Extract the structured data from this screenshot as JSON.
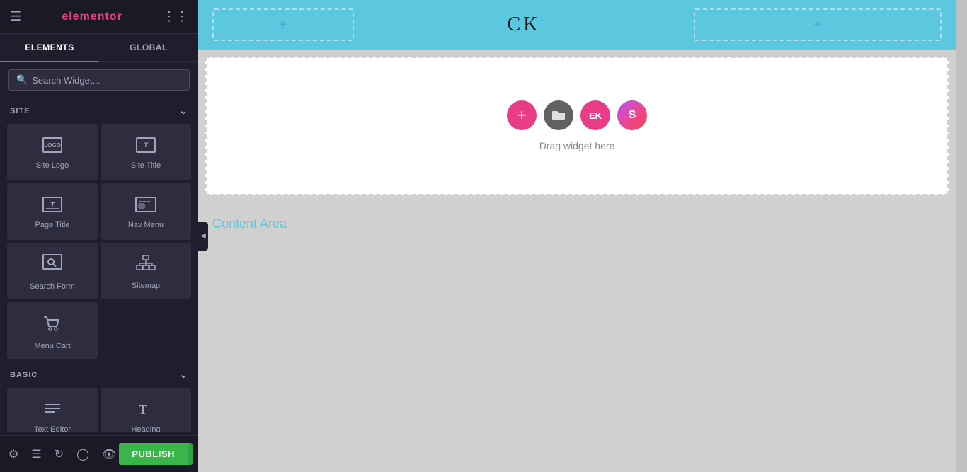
{
  "panel": {
    "logo": "elementor",
    "tabs": [
      {
        "label": "ELEMENTS",
        "active": true
      },
      {
        "label": "GLOBAL",
        "active": false
      }
    ],
    "search_placeholder": "Search Widget...",
    "sections": [
      {
        "name": "SITE",
        "widgets": [
          {
            "label": "Site Logo",
            "icon": "logo"
          },
          {
            "label": "Site Title",
            "icon": "title"
          },
          {
            "label": "Page Title",
            "icon": "page-title"
          },
          {
            "label": "Nav Menu",
            "icon": "nav-menu"
          },
          {
            "label": "Search Form",
            "icon": "search-form"
          },
          {
            "label": "Sitemap",
            "icon": "sitemap"
          },
          {
            "label": "Menu Cart",
            "icon": "cart"
          }
        ]
      },
      {
        "name": "BASIC",
        "widgets": [
          {
            "label": "Text Editor",
            "icon": "text-editor"
          },
          {
            "label": "Heading",
            "icon": "heading"
          }
        ]
      }
    ]
  },
  "toolbar": {
    "publish_label": "PUBLISH",
    "arrow_label": "▲"
  },
  "canvas": {
    "header": {
      "logo_text": "CK",
      "add_icon": "+",
      "right_add_icon": "+"
    },
    "drop_section": {
      "drag_text": "Drag widget here",
      "action_buttons": [
        {
          "label": "+",
          "type": "add"
        },
        {
          "label": "▣",
          "type": "folder"
        },
        {
          "label": "EK",
          "type": "ek"
        },
        {
          "label": "S",
          "type": "s"
        }
      ]
    },
    "content_area_label": "Content Area"
  }
}
